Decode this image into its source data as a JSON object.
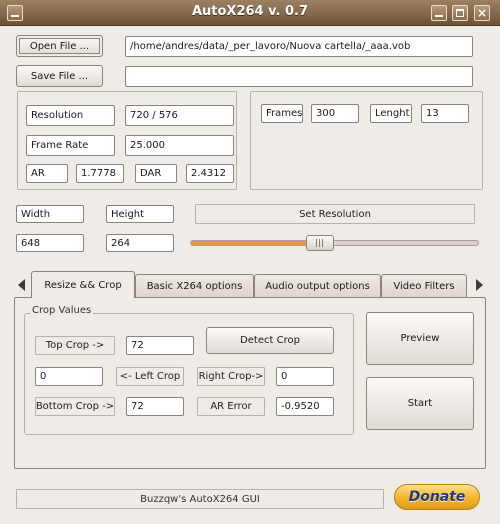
{
  "window": {
    "title": "AutoX264 v. 0.7",
    "close_glyph": "×"
  },
  "file": {
    "open_label": "Open File ...",
    "open_path": "/home/andres/data/_per_lavoro/Nuova cartella/_aaa.vob",
    "save_label": "Save File ...",
    "save_path": ""
  },
  "video_info": {
    "resolution_label": "Resolution",
    "resolution_value": "720 / 576",
    "framerate_label": "Frame Rate",
    "framerate_value": "25.000",
    "ar_label": "AR",
    "ar_value": "1.7778",
    "dar_label": "DAR",
    "dar_value": "2.4312",
    "frames_label": "Frames",
    "frames_value": "300",
    "length_label": "Lenght",
    "length_value": "13"
  },
  "resize": {
    "width_label": "Width",
    "height_label": "Height",
    "width_value": "648",
    "height_value": "264",
    "set_resolution_label": "Set Resolution",
    "slider_fraction": 0.45
  },
  "tabs": [
    {
      "label": "Resize && Crop",
      "active": true
    },
    {
      "label": "Basic X264 options",
      "active": false
    },
    {
      "label": "Audio output options",
      "active": false
    },
    {
      "label": "Video Filters",
      "active": false
    }
  ],
  "crop": {
    "group_title": "Crop Values",
    "top_label": "Top Crop ->",
    "top_value": "72",
    "detect_label": "Detect Crop",
    "left_value": "0",
    "left_label": "<- Left Crop",
    "right_label": "Right Crop->",
    "right_value": "0",
    "bottom_label": "Bottom Crop ->",
    "bottom_value": "72",
    "ar_error_label": "AR Error",
    "ar_error_value": "-0.9520"
  },
  "actions": {
    "preview_label": "Preview",
    "start_label": "Start"
  },
  "status_text": "Buzzqw's AutoX264 GUI",
  "donate_label": "Donate",
  "colors": {
    "titlebar": "#8a6d4d",
    "slider_fill": "#e79a3c",
    "donate": "#f4b42a"
  }
}
